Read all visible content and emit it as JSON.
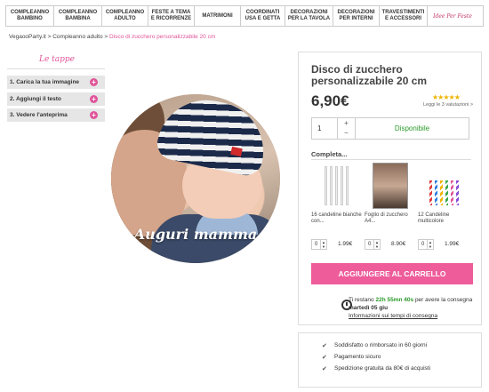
{
  "nav": {
    "items": [
      {
        "label": "COMPLEANNO BAMBINO"
      },
      {
        "label": "COMPLEANNO BAMBINA"
      },
      {
        "label": "COMPLEANNO ADULTO"
      },
      {
        "label": "FESTE A TEMA E RICORRENZE"
      },
      {
        "label": "MATRIMONI"
      },
      {
        "label": "COORDINATI USA E GETTA"
      },
      {
        "label": "DECORAZIONI PER LA TAVOLA"
      },
      {
        "label": "DECORAZIONI PER INTERNI"
      },
      {
        "label": "TRAVESTIMENTI E ACCESSORI"
      },
      {
        "label": "Idee Per Feste"
      }
    ]
  },
  "breadcrumb": {
    "root": "VegaooParty.it",
    "sep1": ">",
    "parent": "Compleanno adulto",
    "sep2": ">",
    "current": "Disco di zucchero personalizzabile 20 cm"
  },
  "steps": {
    "title": "Le tappe",
    "items": [
      {
        "label": "1. Carica la tua immagine"
      },
      {
        "label": "2. Aggiungi il testo"
      },
      {
        "label": "3. Vedere l'anteprima"
      }
    ]
  },
  "preview": {
    "caption": "Auguri mamma"
  },
  "product": {
    "title": "Disco di zucchero personalizzabile 20 cm",
    "price": "6,90€",
    "rating_stars": "★★★★★",
    "reviews": "Leggi le 3 valutazioni >",
    "rating": 5,
    "quantity": "1",
    "plus": "+",
    "minus": "−",
    "availability": "Disponibile"
  },
  "complete": {
    "title": "Completa...",
    "accessories": [
      {
        "name": "16 candeline bianche con...",
        "qty": "0",
        "price": "1.99€"
      },
      {
        "name": "Foglio di zucchero A4...",
        "qty": "0",
        "price": "8.90€"
      },
      {
        "name": "12 Candeline multicolore",
        "qty": "0",
        "price": "1.99€"
      }
    ]
  },
  "cart": {
    "add_label": "AGGIUNGERE AL CARRELLO"
  },
  "shipping": {
    "prefix": "Ti restano",
    "time": "22h 55mn 40s",
    "middle": "per avere la consegna",
    "date": "martedì 05 giu",
    "link": "Informazioni sui tempi di consegna"
  },
  "guarantees": [
    {
      "label": "Soddisfatto o rimborsato in 60 giorni"
    },
    {
      "label": "Pagamento sicuro"
    },
    {
      "label": "Spedizione gratuita da 80€ di acquisti"
    }
  ],
  "colors": {
    "accent": "#ee5c9a",
    "available": "#2a9a2a",
    "stars": "#f0b400"
  }
}
